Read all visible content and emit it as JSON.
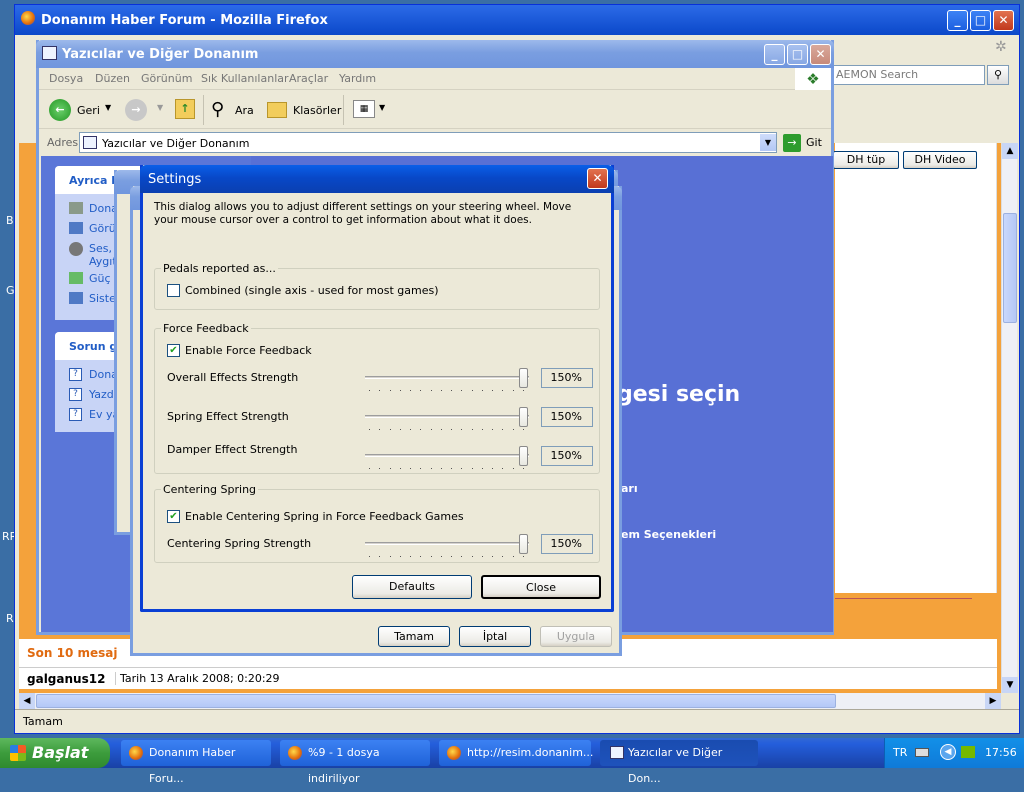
{
  "firefox": {
    "title": "Donanım Haber Forum - Mozilla Firefox",
    "search_placeholder": "AEMON Search",
    "tabs_right": [
      "DH tüp",
      "DH Video"
    ],
    "status": "Tamam",
    "recent_label": "Son 10 mesaj",
    "post_user": "galganus12",
    "post_date": "Tarih 13 Aralık 2008; 0:20:29"
  },
  "explorer": {
    "title": "Yazıcılar ve Diğer Donanım",
    "menu": [
      "Dosya",
      "Düzen",
      "Görünüm",
      "Sık Kullanılanlar",
      "Araçlar",
      "Yardım"
    ],
    "back_label": "Geri",
    "search_label": "Ara",
    "folders_label": "Klasörler",
    "address_label": "Adres",
    "address_value": "Yazıcılar ve Diğer Donanım",
    "go_label": "Git",
    "side_panel_1_title": "Ayrıca b",
    "side_panel_1_items": [
      "Dona",
      "Görün",
      "Ses, Aygıt",
      "Güç S",
      "Sister"
    ],
    "side_panel_2_title": "Sorun gi",
    "side_panel_2_items": [
      "Dona",
      "Yazdı",
      "Ev ya"
    ],
    "main_heading": "gesi seçin",
    "main_link_1": "arı",
    "main_link_2": "em Seçenekleri"
  },
  "props": {
    "ok": "Tamam",
    "cancel": "İptal",
    "apply": "Uygula"
  },
  "settings": {
    "title": "Settings",
    "description": "This dialog allows you to adjust different settings on your steering wheel.  Move your mouse cursor over a control to get information about what it does.",
    "pedals_group": "Pedals reported as...",
    "combined_label": "Combined (single axis - used for most games)",
    "ff_group": "Force Feedback",
    "enable_ff_label": "Enable Force Feedback",
    "sliders": [
      {
        "label": "Overall Effects Strength",
        "value": "150%",
        "fraction": 1.0
      },
      {
        "label": "Spring Effect Strength",
        "value": "150%",
        "fraction": 1.0
      },
      {
        "label": "Damper Effect Strength",
        "value": "150%",
        "fraction": 1.0
      }
    ],
    "cs_group": "Centering Spring",
    "enable_cs_label": "Enable Centering Spring in Force Feedback Games",
    "cs_slider": {
      "label": "Centering Spring Strength",
      "value": "150%",
      "fraction": 1.0
    },
    "defaults_button": "Defaults",
    "close_button": "Close"
  },
  "taskbar": {
    "start": "Başlat",
    "items": [
      "Donanım Haber Foru...",
      "%9 - 1 dosya indiriliyor",
      "http://resim.donanim...",
      "Yazıcılar ve Diğer Don..."
    ],
    "lang": "TR",
    "clock": "17:56"
  },
  "desktop_letters": [
    "B",
    "G",
    "RR",
    "R"
  ]
}
